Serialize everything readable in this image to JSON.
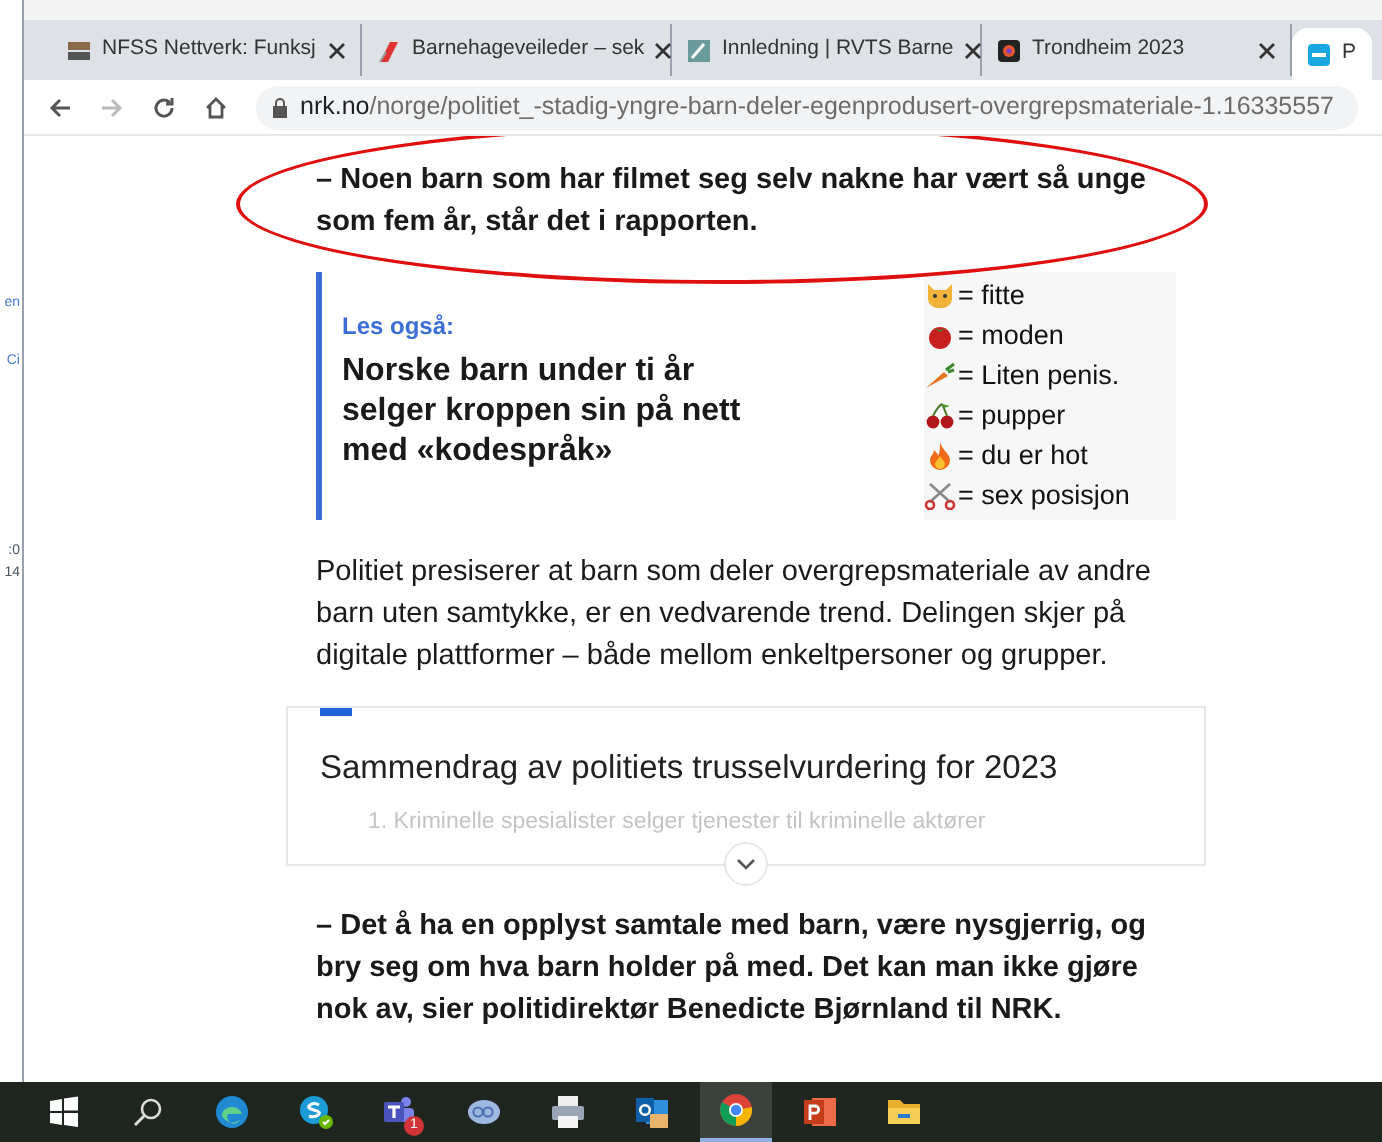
{
  "desktop_fragments": [
    "en",
    "Ci",
    ":0",
    "14"
  ],
  "browser": {
    "tabs": [
      {
        "title": "NFSS Nettverk: Funksj",
        "kind": "nfss",
        "selected": false
      },
      {
        "title": "Barnehageveileder – sek",
        "kind": "flag",
        "selected": false
      },
      {
        "title": "Innledning | RVTS Barne",
        "kind": "rvts",
        "selected": false
      },
      {
        "title": "Trondheim 2023",
        "kind": "logo",
        "selected": false
      },
      {
        "title": "P",
        "kind": "nrk",
        "selected": true
      }
    ],
    "url_host": "nrk.no",
    "url_path": "/norge/politiet_-stadig-yngre-barn-deler-egenprodusert-overgrepsmateriale-1.16335557"
  },
  "article": {
    "blocks": [
      {
        "kind": "quote",
        "text": "– Noen barn som har filmet seg selv nakne har vært så unge som fem år, står det i rapporten.",
        "highlighted": true
      },
      {
        "kind": "related",
        "label": "Les også:",
        "title": "Norske barn under ti år selger kroppen sin på nett med «kodespråk»",
        "legend": [
          {
            "kind": "cat",
            "text": "= fitte"
          },
          {
            "kind": "tomato",
            "text": "= moden"
          },
          {
            "kind": "carrot",
            "text": "= Liten penis."
          },
          {
            "kind": "cherries",
            "text": "= pupper"
          },
          {
            "kind": "fire",
            "text": "= du er hot"
          },
          {
            "kind": "scissors",
            "text": "= sex posisjon"
          }
        ]
      },
      {
        "kind": "text",
        "text": "Politiet presiserer at barn som deler overgrepsmateriale av andre barn uten samtykke, er en vedvarende trend. Delingen skjer på digitale plattformer – både mellom enkeltpersoner og grupper."
      },
      {
        "kind": "factbox",
        "title": "Sammendrag av politiets trusselvurdering for 2023",
        "items": [
          "1. Kriminelle spesialister selger tjenester til kriminelle aktører"
        ],
        "expanded": false
      },
      {
        "kind": "quote",
        "text": "– Det å ha en opplyst samtale med barn, være nysgjerrig, og bry seg om hva barn holder på med. Det kan man ikke gjøre nok av, sier politidirektør Benedicte Bjørnland til NRK.",
        "highlighted": false
      }
    ]
  },
  "taskbar": [
    {
      "kind": "windows",
      "selected": false
    },
    {
      "kind": "search",
      "selected": false
    },
    {
      "kind": "edge",
      "selected": false
    },
    {
      "kind": "skype",
      "selected": false
    },
    {
      "kind": "teams",
      "selected": false,
      "badge": "1"
    },
    {
      "kind": "chat",
      "selected": false
    },
    {
      "kind": "printer",
      "selected": false
    },
    {
      "kind": "outlook",
      "selected": false
    },
    {
      "kind": "chrome",
      "selected": true
    },
    {
      "kind": "powerpoint",
      "selected": false
    },
    {
      "kind": "folder",
      "selected": false
    }
  ]
}
